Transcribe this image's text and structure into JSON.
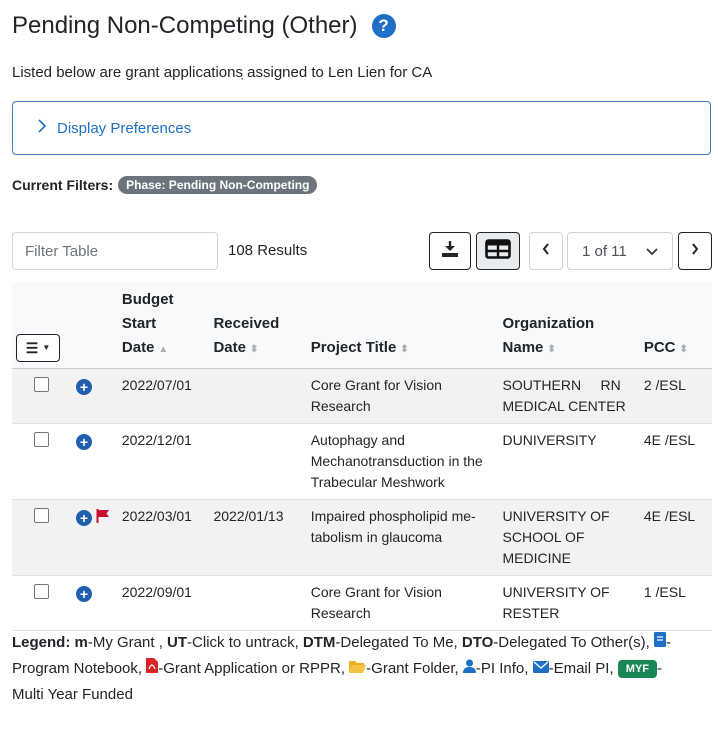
{
  "header": {
    "title": "Pending Non-Competing (Other)",
    "subtitle": "Listed below are grant applications ̣assigned to Len Lien for CA",
    "help_glyph": "?"
  },
  "preferences": {
    "label": "Display Preferences"
  },
  "filters": {
    "label": "Current Filters:",
    "badge": "Phase: Pending Non-Competing"
  },
  "toolbar": {
    "filter_placeholder": "Filter Table",
    "results": "108 Results",
    "page_select": "1 of 11"
  },
  "table": {
    "columns": {
      "budget": [
        "Budget",
        "Start",
        "Date"
      ],
      "received": [
        "Received",
        "Date"
      ],
      "project": "Project Title",
      "org": [
        "Organization",
        "Name"
      ],
      "pcc": "PCC"
    },
    "rows": [
      {
        "budget_start": "2022/07/01",
        "received": "",
        "title": [
          "Core Grant for Vision",
          "Research"
        ],
        "org": [
          "SOUTHERN     RN",
          "MEDICAL CENTER"
        ],
        "pcc": "2 /ESL",
        "flag": false
      },
      {
        "budget_start": "2022/12/01",
        "received": "",
        "title": [
          "Autophagy and",
          "Mechanotransduction in the",
          "Trabecular Meshwork"
        ],
        "org": [
          "DUNIVERSITY"
        ],
        "pcc": "4E /ESL",
        "flag": false
      },
      {
        "budget_start": "2022/03/01",
        "received": "2022/01/13",
        "title": [
          "Impaired phospholipid me-",
          "tabolism in glaucoma"
        ],
        "org": [
          "UNIVERSITY OF",
          "SCHOOL OF",
          "MEDICINE"
        ],
        "pcc": "4E /ESL",
        "flag": true
      },
      {
        "budget_start": "2022/09/01",
        "received": "",
        "title": [
          "Core Grant for Vision",
          "Research"
        ],
        "org": [
          "UNIVERSITY OF",
          "RESTER"
        ],
        "pcc": "1 /ESL",
        "flag": false
      }
    ]
  },
  "legend": {
    "label": "Legend:",
    "m": "m",
    "m_text": "-My Grant ,",
    "ut": "UT",
    "ut_text": "-Click to untrack,",
    "dtm": "DTM",
    "dtm_text": "-Delegated To Me,",
    "dto": "DTO",
    "dto_text": "-Delegated To Other(s),",
    "notebook": "-Program Notebook,",
    "pdf": "-Grant Application or RPPR,",
    "folder": "-Grant Folder,",
    "pi": "-PI Info,",
    "email": "-Email PI,",
    "myf": "MYF",
    "myf_text": "-",
    "myf_text2": "Multi Year Funded"
  },
  "colors": {
    "accent": "#1f6fc5",
    "flag": "#c8102e",
    "myf": "#198754"
  }
}
